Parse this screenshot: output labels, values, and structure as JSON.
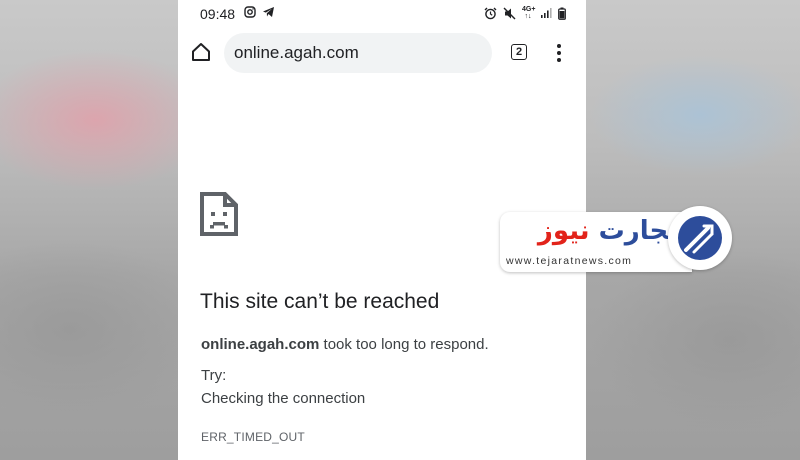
{
  "status_bar": {
    "time": "09:48",
    "left_icons": [
      "instagram-icon",
      "telegram-icon"
    ],
    "right_icons": [
      "alarm-icon",
      "mute-icon",
      "network-4g-icon",
      "signal-icon",
      "battery-icon"
    ],
    "network_label": "4G+"
  },
  "toolbar": {
    "url": "online.agah.com",
    "tab_count": "2"
  },
  "error": {
    "title": "This site can’t be reached",
    "host": "online.agah.com",
    "message": "took too long to respond.",
    "try_label": "Try:",
    "suggestion": "Checking the connection",
    "code": "ERR_TIMED_OUT"
  },
  "watermark": {
    "brand_part1": "تجارت",
    "brand_part2": "نیوز",
    "url": "www.tejaratnews.com",
    "brand_color_1": "#2d4d9b",
    "brand_color_2": "#e2231a"
  }
}
